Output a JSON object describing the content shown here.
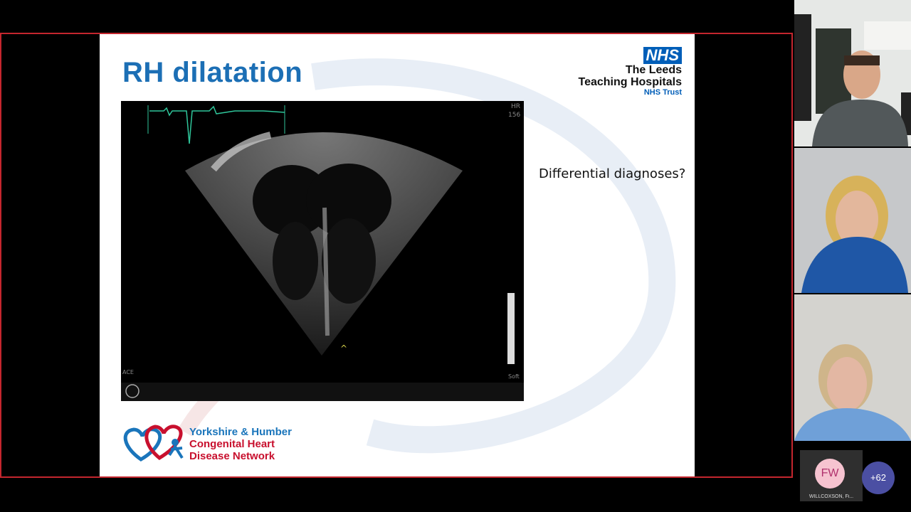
{
  "slide": {
    "title": "RH dilatation",
    "nhs_badge": "NHS",
    "nhs_line1": "The Leeds",
    "nhs_line2": "Teaching Hospitals",
    "nhs_trust": "NHS Trust",
    "question": "Differential diagnoses?",
    "echo_labels": {
      "hr": "HR",
      "hr_value": "156",
      "ace": "ACE",
      "soft": "Soft"
    },
    "network": {
      "line1": "Yorkshire & Humber",
      "line2": "Congenital Heart",
      "line3": "Disease Network"
    }
  },
  "participants": {
    "avatar_initials": "FW",
    "avatar_name": "WILLCOXSON, Fi...",
    "more_count": "+62"
  },
  "colors": {
    "frame_border": "#c4262e",
    "title_blue": "#1c6fb5",
    "nhs_blue": "#005eb8",
    "network_red": "#c8102e",
    "ecg_green": "#2fc59a"
  }
}
